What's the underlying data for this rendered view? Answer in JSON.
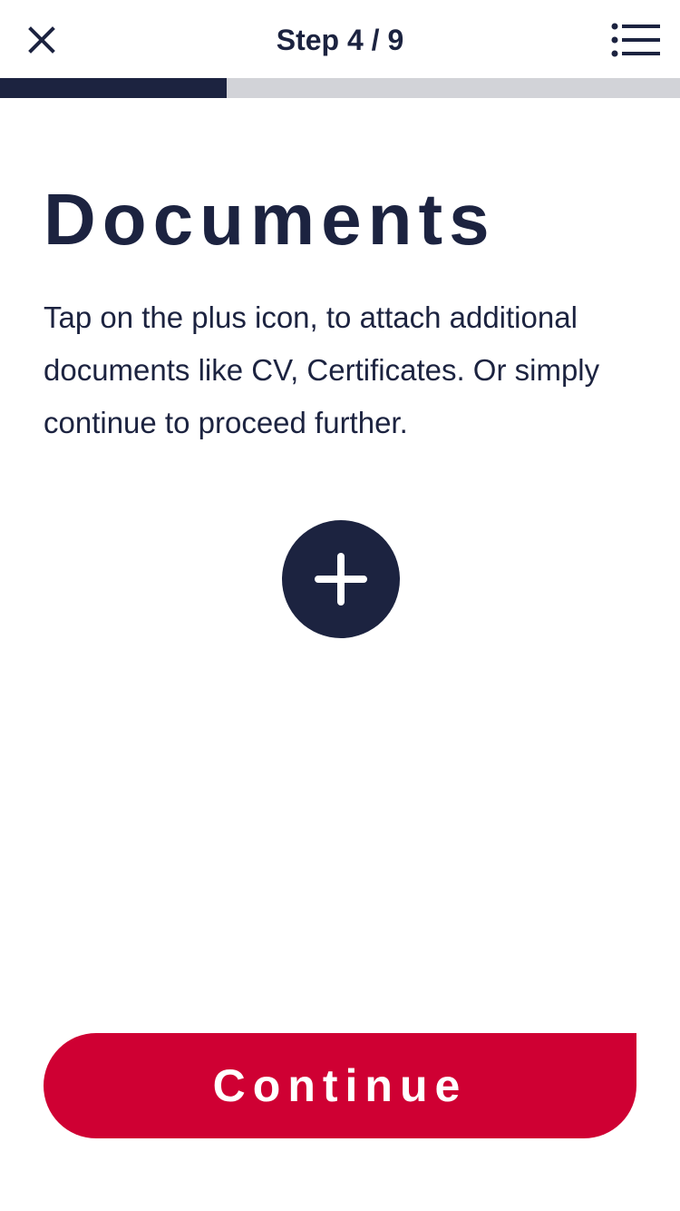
{
  "header": {
    "step_label": "Step 4 / 9",
    "close_icon": "close-icon",
    "menu_icon": "list-menu-icon"
  },
  "progress": {
    "current_step": 4,
    "total_steps": 9,
    "fraction": 0.333
  },
  "main": {
    "title": "Documents",
    "description": "Tap on the plus icon, to attach additional documents like CV, Certificates. Or simply continue to proceed further.",
    "add_icon": "plus-icon"
  },
  "footer": {
    "continue_label": "Continue"
  },
  "colors": {
    "navy": "#1c2340",
    "accent_red": "#cf0033",
    "progress_track": "#d2d3d8",
    "background": "#ffffff"
  }
}
